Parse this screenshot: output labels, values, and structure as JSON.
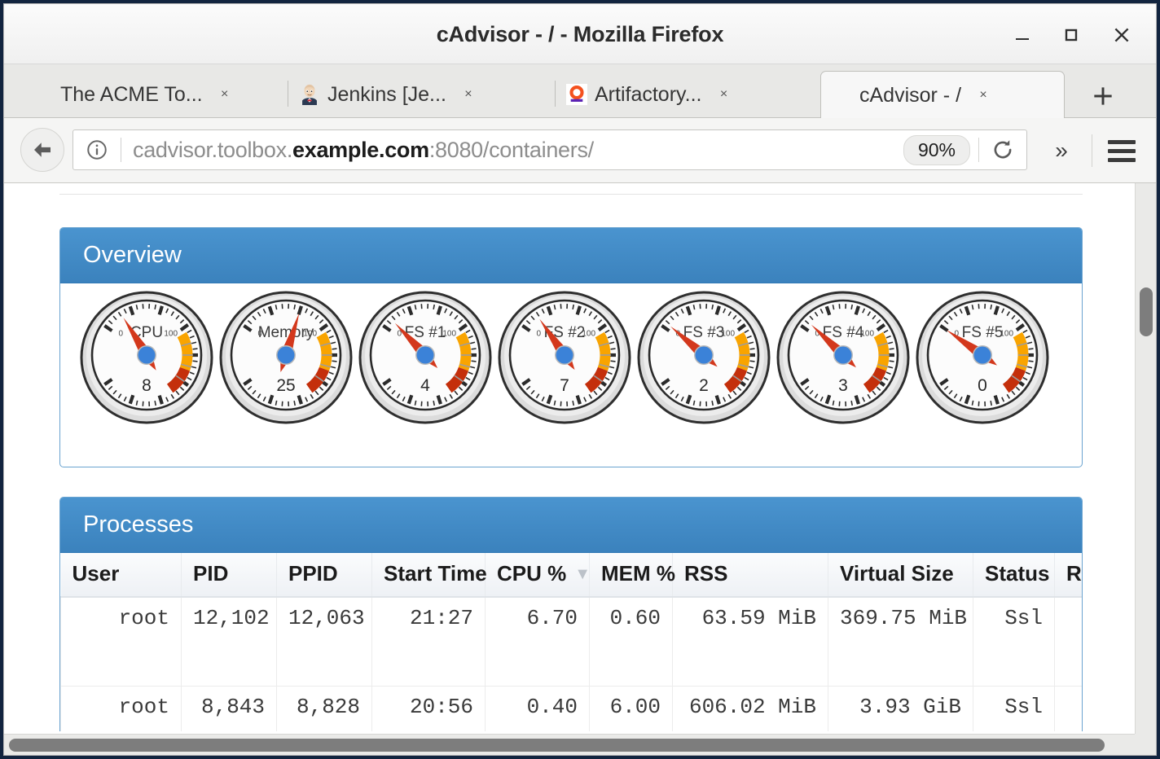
{
  "window": {
    "title": "cAdvisor - / - Mozilla Firefox",
    "minimize_label": "Minimize",
    "maximize_label": "Maximize",
    "close_label": "Close"
  },
  "tabs": [
    {
      "label": "The ACME To...",
      "favicon": "none",
      "close_label": "×",
      "active": false
    },
    {
      "label": "Jenkins [Je...",
      "favicon": "jenkins-butler-icon",
      "close_label": "×",
      "active": false
    },
    {
      "label": "Artifactory...",
      "favicon": "artifactory-icon",
      "close_label": "×",
      "active": false
    },
    {
      "label": "cAdvisor - /",
      "favicon": "none",
      "close_label": "×",
      "active": true
    }
  ],
  "new_tab_label": "+",
  "navbar": {
    "back_icon": "back-arrow-icon",
    "identity_icon": "info-circle-icon",
    "url_prefix": "cadvisor.toolbox.",
    "url_domain": "example.com",
    "url_suffix": ":8080/containers/",
    "url_full": "cadvisor.toolbox.example.com:8080/containers/",
    "zoom_level": "90%",
    "reload_icon": "reload-icon",
    "overflow_label": "»",
    "menu_icon": "hamburger-menu-icon"
  },
  "page": {
    "overview": {
      "title": "Overview",
      "gauges": [
        {
          "label": "CPU",
          "value": "8",
          "min": "0",
          "max": "100"
        },
        {
          "label": "Memory",
          "value": "25",
          "min": "0",
          "max": "100"
        },
        {
          "label": "FS #1",
          "value": "4",
          "min": "0",
          "max": "100"
        },
        {
          "label": "FS #2",
          "value": "7",
          "min": "0",
          "max": "100"
        },
        {
          "label": "FS #3",
          "value": "2",
          "min": "0",
          "max": "100"
        },
        {
          "label": "FS #4",
          "value": "3",
          "min": "0",
          "max": "100"
        },
        {
          "label": "FS #5",
          "value": "0",
          "min": "0",
          "max": "100"
        }
      ]
    },
    "processes": {
      "title": "Processes",
      "columns": [
        {
          "key": "user",
          "label": "User",
          "align": "left",
          "sorted": false
        },
        {
          "key": "pid",
          "label": "PID",
          "align": "left",
          "sorted": false
        },
        {
          "key": "ppid",
          "label": "PPID",
          "align": "left",
          "sorted": false
        },
        {
          "key": "start",
          "label": "Start Time",
          "align": "left",
          "sorted": false
        },
        {
          "key": "cpu",
          "label": "CPU %",
          "align": "left",
          "sorted": true,
          "sort_caret": "▼"
        },
        {
          "key": "mem",
          "label": "MEM %",
          "align": "left",
          "sorted": false
        },
        {
          "key": "rss",
          "label": "RSS",
          "align": "left",
          "sorted": false
        },
        {
          "key": "vsize",
          "label": "Virtual Size",
          "align": "left",
          "sorted": false
        },
        {
          "key": "status",
          "label": "Status",
          "align": "left",
          "sorted": false
        },
        {
          "key": "run",
          "label": "Ru",
          "align": "left",
          "sorted": false
        }
      ],
      "rows": [
        {
          "user": "root",
          "pid": "12,102",
          "ppid": "12,063",
          "start": "21:27",
          "cpu": "6.70",
          "mem": "0.60",
          "rss": "63.59 MiB",
          "vsize": "369.75 MiB",
          "status": "Ssl",
          "run": ""
        },
        {
          "user": "root",
          "pid": "8,843",
          "ppid": "8,828",
          "start": "20:56",
          "cpu": "0.40",
          "mem": "6.00",
          "rss": "606.02 MiB",
          "vsize": "3.93 GiB",
          "status": "Ssl",
          "run": ""
        }
      ]
    }
  },
  "colors": {
    "panel_header": "#3b82bd",
    "panel_border": "#6aa3d0",
    "gauge_needle": "#d3381c",
    "gauge_hub": "#3b82d8",
    "gauge_warn": "#f9a400",
    "gauge_danger": "#c42f0b",
    "scrollbar_thumb": "#7d7d7d",
    "window_chrome": "#12243f"
  },
  "scrollbars": {
    "vertical_label": "vertical-scrollbar",
    "horizontal_label": "horizontal-scrollbar"
  }
}
